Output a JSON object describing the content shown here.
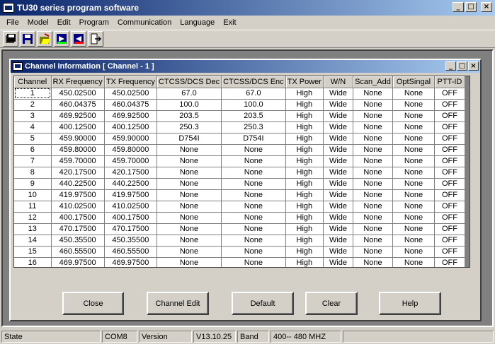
{
  "window": {
    "title": "TU30 series program software",
    "min": "_",
    "max": "□",
    "close": "×"
  },
  "menu": [
    "File",
    "Model",
    "Edit",
    "Program",
    "Communication",
    "Language",
    "Exit"
  ],
  "toolbar": {
    "icons": [
      "save-all-icon",
      "save-icon",
      "open-icon",
      "read-icon",
      "write-icon",
      "exit-icon"
    ]
  },
  "child": {
    "title": "Channel Information [ Channel -  1 ]"
  },
  "grid": {
    "columns": [
      "Channel",
      "RX Frequency",
      "TX Frequency",
      "CTCSS/DCS Dec",
      "CTCSS/DCS Enc",
      "TX Power",
      "W/N",
      "Scan_Add",
      "OptSingal",
      "PTT-ID"
    ],
    "rows": [
      [
        "1",
        "450.02500",
        "450.02500",
        "67.0",
        "67.0",
        "High",
        "Wide",
        "None",
        "None",
        "OFF"
      ],
      [
        "2",
        "460.04375",
        "460.04375",
        "100.0",
        "100.0",
        "High",
        "Wide",
        "None",
        "None",
        "OFF"
      ],
      [
        "3",
        "469.92500",
        "469.92500",
        "203.5",
        "203.5",
        "High",
        "Wide",
        "None",
        "None",
        "OFF"
      ],
      [
        "4",
        "400.12500",
        "400.12500",
        "250.3",
        "250.3",
        "High",
        "Wide",
        "None",
        "None",
        "OFF"
      ],
      [
        "5",
        "459.90000",
        "459.90000",
        "D754I",
        "D754I",
        "High",
        "Wide",
        "None",
        "None",
        "OFF"
      ],
      [
        "6",
        "459.80000",
        "459.80000",
        "None",
        "None",
        "High",
        "Wide",
        "None",
        "None",
        "OFF"
      ],
      [
        "7",
        "459.70000",
        "459.70000",
        "None",
        "None",
        "High",
        "Wide",
        "None",
        "None",
        "OFF"
      ],
      [
        "8",
        "420.17500",
        "420.17500",
        "None",
        "None",
        "High",
        "Wide",
        "None",
        "None",
        "OFF"
      ],
      [
        "9",
        "440.22500",
        "440.22500",
        "None",
        "None",
        "High",
        "Wide",
        "None",
        "None",
        "OFF"
      ],
      [
        "10",
        "419.97500",
        "419.97500",
        "None",
        "None",
        "High",
        "Wide",
        "None",
        "None",
        "OFF"
      ],
      [
        "11",
        "410.02500",
        "410.02500",
        "None",
        "None",
        "High",
        "Wide",
        "None",
        "None",
        "OFF"
      ],
      [
        "12",
        "400.17500",
        "400.17500",
        "None",
        "None",
        "High",
        "Wide",
        "None",
        "None",
        "OFF"
      ],
      [
        "13",
        "470.17500",
        "470.17500",
        "None",
        "None",
        "High",
        "Wide",
        "None",
        "None",
        "OFF"
      ],
      [
        "14",
        "450.35500",
        "450.35500",
        "None",
        "None",
        "High",
        "Wide",
        "None",
        "None",
        "OFF"
      ],
      [
        "15",
        "460.55500",
        "460.55500",
        "None",
        "None",
        "High",
        "Wide",
        "None",
        "None",
        "OFF"
      ],
      [
        "16",
        "469.97500",
        "469.97500",
        "None",
        "None",
        "High",
        "Wide",
        "None",
        "None",
        "OFF"
      ]
    ]
  },
  "buttons": {
    "close": "Close",
    "channel_edit": "Channel Edit",
    "default": "Default",
    "clear": "Clear",
    "help": "Help"
  },
  "status": {
    "state_label": "State",
    "port": "COM8",
    "version_label": "Version",
    "version": "V13.10.25",
    "band_label": "Band",
    "band": "400-- 480 MHZ"
  },
  "colors": {
    "title_start": "#0a246a",
    "title_end": "#a6caf0",
    "face": "#d4d0c8",
    "mdi": "#808080"
  }
}
